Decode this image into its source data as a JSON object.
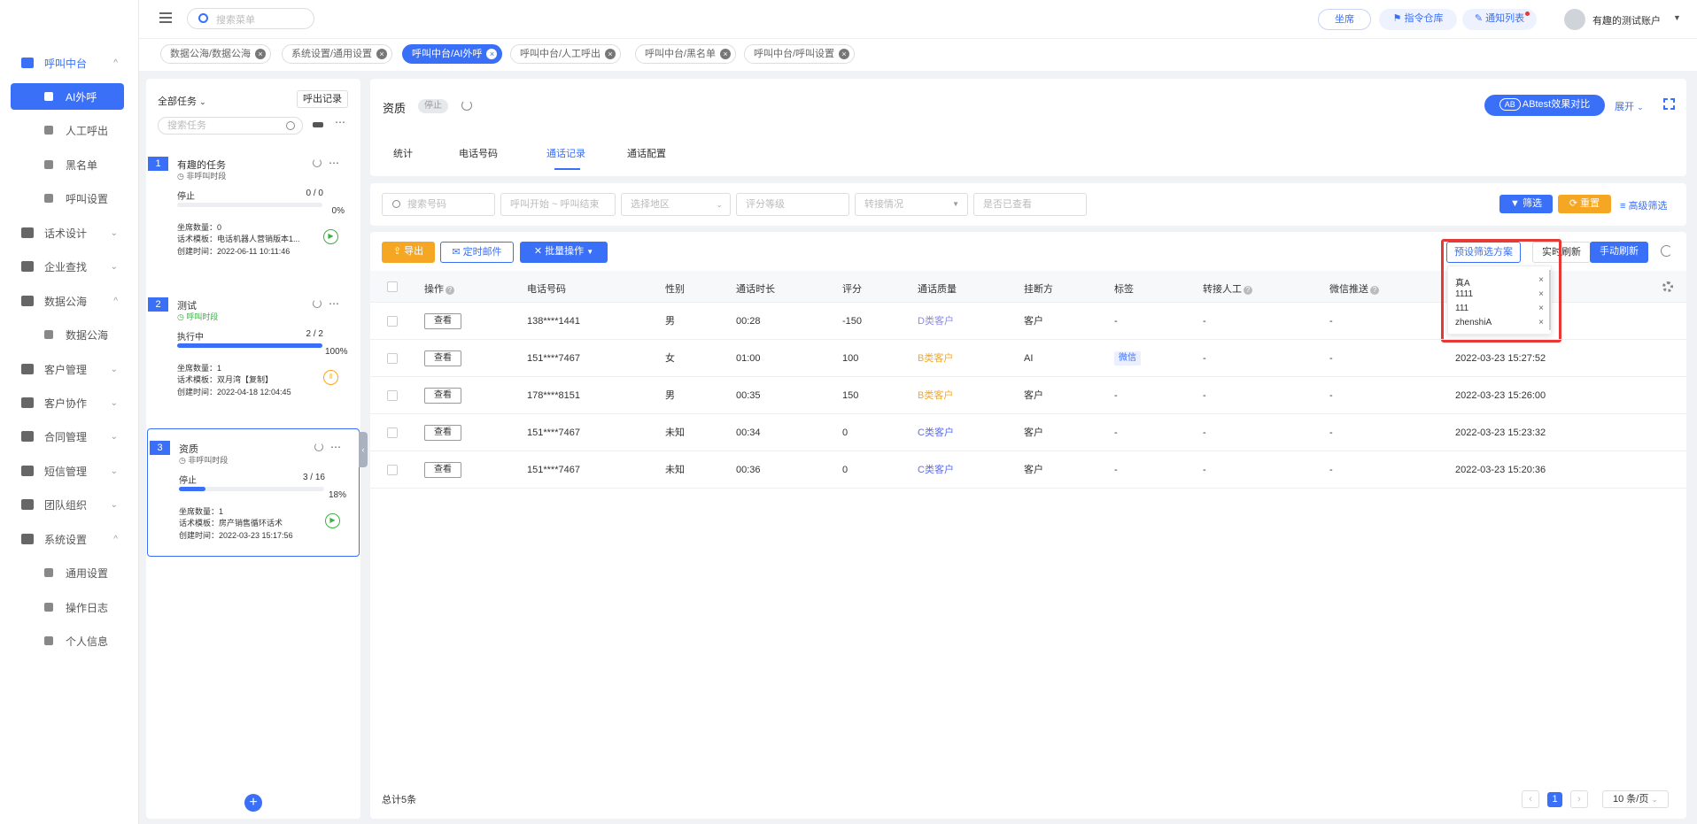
{
  "sidebar": {
    "items": [
      {
        "label": "呼叫中台",
        "icon": "monitor-icon",
        "arrow": "^",
        "active": true
      },
      {
        "label": "AI外呼",
        "icon": "phone-icon",
        "sub": true,
        "selected": true
      },
      {
        "label": "人工呼出",
        "icon": "agent-icon",
        "sub": true
      },
      {
        "label": "黑名单",
        "icon": "warning-icon",
        "sub": true
      },
      {
        "label": "呼叫设置",
        "icon": "sliders-icon",
        "sub": true
      },
      {
        "label": "话术设计",
        "icon": "script-icon",
        "arrow": "v"
      },
      {
        "label": "企业查找",
        "icon": "bulb-icon",
        "arrow": "v"
      },
      {
        "label": "数据公海",
        "icon": "chart-icon",
        "arrow": "^"
      },
      {
        "label": "数据公海",
        "icon": "data-icon",
        "sub": true
      },
      {
        "label": "客户管理",
        "icon": "customer-icon",
        "arrow": "v"
      },
      {
        "label": "客户协作",
        "icon": "collab-icon",
        "arrow": "v"
      },
      {
        "label": "合同管理",
        "icon": "contract-icon",
        "arrow": "v"
      },
      {
        "label": "短信管理",
        "icon": "sms-icon",
        "arrow": "v"
      },
      {
        "label": "团队组织",
        "icon": "team-icon",
        "arrow": "v"
      },
      {
        "label": "系统设置",
        "icon": "system-icon",
        "arrow": "^"
      },
      {
        "label": "通用设置",
        "icon": "gear-icon",
        "sub": true
      },
      {
        "label": "操作日志",
        "icon": "log-icon",
        "sub": true
      },
      {
        "label": "个人信息",
        "icon": "user-icon",
        "sub": true
      }
    ]
  },
  "topbar": {
    "search_placeholder": "搜索菜单",
    "seat": "坐席",
    "command": "指令仓库",
    "notify": "通知列表",
    "account": "有趣的测试账户"
  },
  "tags": [
    {
      "label": "数据公海/数据公海",
      "active": false
    },
    {
      "label": "系统设置/通用设置",
      "active": false
    },
    {
      "label": "呼叫中台/AI外呼",
      "active": true
    },
    {
      "label": "呼叫中台/人工呼出",
      "active": false
    },
    {
      "label": "呼叫中台/黑名单",
      "active": false
    },
    {
      "label": "呼叫中台/呼叫设置",
      "active": false
    }
  ],
  "tasks": {
    "filter": "全部任务",
    "call_records": "呼出记录",
    "search_placeholder": "搜索任务",
    "list": [
      {
        "num": "1",
        "name": "有趣的任务",
        "time": "非呼叫时段",
        "status": "停止",
        "progress": "0 / 0",
        "percent": "0%",
        "fill": 0,
        "seats": "坐席数量：0",
        "template": "话术模板：电话机器人营销版本1...",
        "created": "创建时间：2022-06-11 10:11:46",
        "action": "play"
      },
      {
        "num": "2",
        "name": "测试",
        "time": "呼叫时段",
        "status": "执行中",
        "progress": "2 / 2",
        "percent": "100%",
        "fill": 1,
        "seats": "坐席数量：1",
        "template": "话术模板：双月湾【复制】",
        "created": "创建时间：2022-04-18 12:04:45",
        "action": "pause"
      },
      {
        "num": "3",
        "name": "资质",
        "time": "非呼叫时段",
        "status": "停止",
        "progress": "3 / 16",
        "percent": "18%",
        "fill": 0.18,
        "seats": "坐席数量：1",
        "template": "话术模板：房产销售循环话术",
        "created": "创建时间：2022-03-23 15:17:56",
        "action": "play"
      }
    ]
  },
  "main": {
    "title": "资质",
    "status_badge": "停止",
    "ab_button": "ABtest效果对比",
    "expand": "展开",
    "tabs": [
      "统计",
      "电话号码",
      "通话记录",
      "通话配置"
    ],
    "active_tab": 2,
    "filters": {
      "phone": "搜索号码",
      "range": "呼叫开始 ~ 呼叫结束",
      "region": "选择地区",
      "rating": "评分等级",
      "transfer": "转接情况",
      "viewed": "是否已查看",
      "filter_btn": "筛选",
      "reset_btn": "重置",
      "advanced": "高级筛选"
    },
    "actions": {
      "export": "导出",
      "mail": "定时邮件",
      "batch": "批量操作",
      "preset": "预设筛选方案",
      "realtime": "实时刷新",
      "manual": "手动刷新"
    },
    "preset_items": [
      "真A",
      "1111",
      "111",
      "zhenshiA"
    ],
    "columns": [
      "操作",
      "电话号码",
      "性别",
      "通话时长",
      "评分",
      "通话质量",
      "挂断方",
      "标签",
      "转接人工",
      "微信推送"
    ],
    "view_label": "查看",
    "rows": [
      {
        "phone": "138****1441",
        "gender": "男",
        "duration": "00:28",
        "score": "-150",
        "quality": "D类客户",
        "qcolor": "#8a8ae0",
        "hangup": "客户",
        "tag": "-",
        "transfer": "-",
        "wechat": "-",
        "time": ""
      },
      {
        "phone": "151****7467",
        "gender": "女",
        "duration": "01:00",
        "score": "100",
        "quality": "B类客户",
        "qcolor": "#f5a623",
        "hangup": "AI",
        "tag": "微信",
        "transfer": "-",
        "wechat": "-",
        "time": "2022-03-23 15:27:52"
      },
      {
        "phone": "178****8151",
        "gender": "男",
        "duration": "00:35",
        "score": "150",
        "quality": "B类客户",
        "qcolor": "#f5a623",
        "hangup": "客户",
        "tag": "-",
        "transfer": "-",
        "wechat": "-",
        "time": "2022-03-23 15:26:00"
      },
      {
        "phone": "151****7467",
        "gender": "未知",
        "duration": "00:34",
        "score": "0",
        "quality": "C类客户",
        "qcolor": "#5b6cf0",
        "hangup": "客户",
        "tag": "-",
        "transfer": "-",
        "wechat": "-",
        "time": "2022-03-23 15:23:32"
      },
      {
        "phone": "151****7467",
        "gender": "未知",
        "duration": "00:36",
        "score": "0",
        "quality": "C类客户",
        "qcolor": "#5b6cf0",
        "hangup": "客户",
        "tag": "-",
        "transfer": "-",
        "wechat": "-",
        "time": "2022-03-23 15:20:36"
      }
    ],
    "total": "总计5条",
    "page": "1",
    "page_size": "10 条/页"
  },
  "colors": {
    "accent": "#3a6ff7",
    "orange": "#f5a623",
    "highlight": "#e53935"
  }
}
